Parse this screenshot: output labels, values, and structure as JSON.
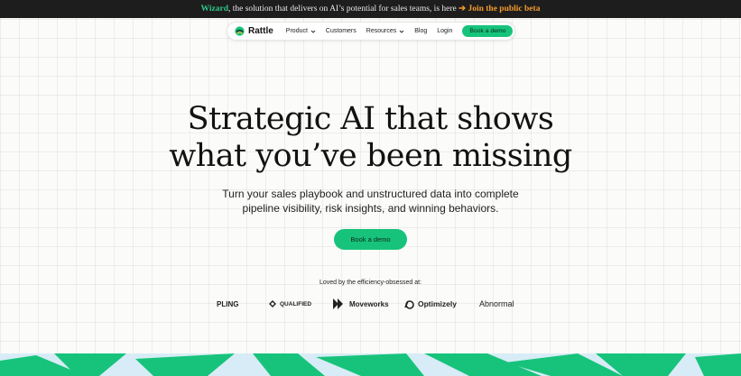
{
  "announcement": {
    "highlight": "Wizard",
    "text": ", the solution that delivers on AI’s potential for sales teams, is here",
    "arrow": "➔",
    "link": "Join the public beta"
  },
  "nav": {
    "logo_text": "Rattle",
    "items": [
      {
        "label": "Product",
        "has_dropdown": true
      },
      {
        "label": "Customers",
        "has_dropdown": false
      },
      {
        "label": "Resources",
        "has_dropdown": true
      },
      {
        "label": "Blog",
        "has_dropdown": false
      },
      {
        "label": "Login",
        "has_dropdown": false
      }
    ],
    "cta": "Book a demo"
  },
  "hero": {
    "headline_line1": "Strategic AI that shows",
    "headline_line2": "what you’ve been missing",
    "sub_line1": "Turn your sales playbook and unstructured data into complete",
    "sub_line2": "pipeline visibility, risk insights, and winning behaviors.",
    "cta": "Book a demo"
  },
  "logos": {
    "label": "Loved by the efficiency-obsessed at:",
    "brands": [
      "PLING",
      "QUALIFIED",
      "Moveworks",
      "Optimizely",
      "Abnormal"
    ]
  },
  "colors": {
    "accent": "#17c37b",
    "announce_bg": "#1d1d1d",
    "wizard": "#30c787",
    "beta_link": "#f29a2e"
  }
}
